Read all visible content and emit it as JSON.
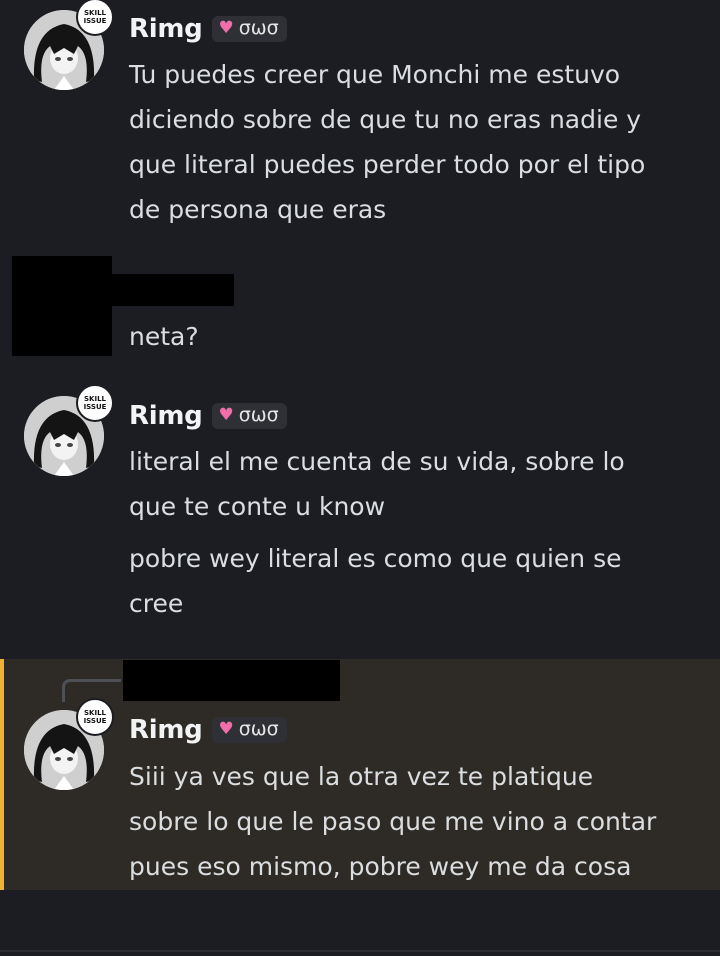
{
  "messages": [
    {
      "author": "Rimg",
      "tag_text": "σωσ",
      "badge_line1": "SKILL",
      "badge_line2": "ISSUE",
      "lines": [
        "Tu puedes creer que Monchi me estuvo",
        "diciendo sobre de que tu no eras nadie y",
        "que literal puedes perder todo por el tipo",
        "de persona que eras"
      ]
    },
    {
      "author": "",
      "lines": [
        "neta?"
      ]
    },
    {
      "author": "Rimg",
      "tag_text": "σωσ",
      "badge_line1": "SKILL",
      "badge_line2": "ISSUE",
      "lines": [
        "literal el me cuenta de su vida, sobre lo",
        "que te conte u know"
      ],
      "lines2": [
        "pobre wey literal es como que quien se",
        "cree"
      ]
    },
    {
      "author": "Rimg",
      "tag_text": "σωσ",
      "badge_line1": "SKILL",
      "badge_line2": "ISSUE",
      "lines": [
        "Siii ya ves que la otra vez te platique",
        "sobre lo que le paso que me vino a contar",
        "pues eso mismo, pobre wey me da cosa"
      ]
    }
  ],
  "colors": {
    "background": "#1c1d22",
    "highlight": "#2e2b26",
    "highlight_bar": "#f0b232",
    "heart": "#f06ea9"
  },
  "icons": {
    "tag_icon": "pink-heart-icon"
  }
}
